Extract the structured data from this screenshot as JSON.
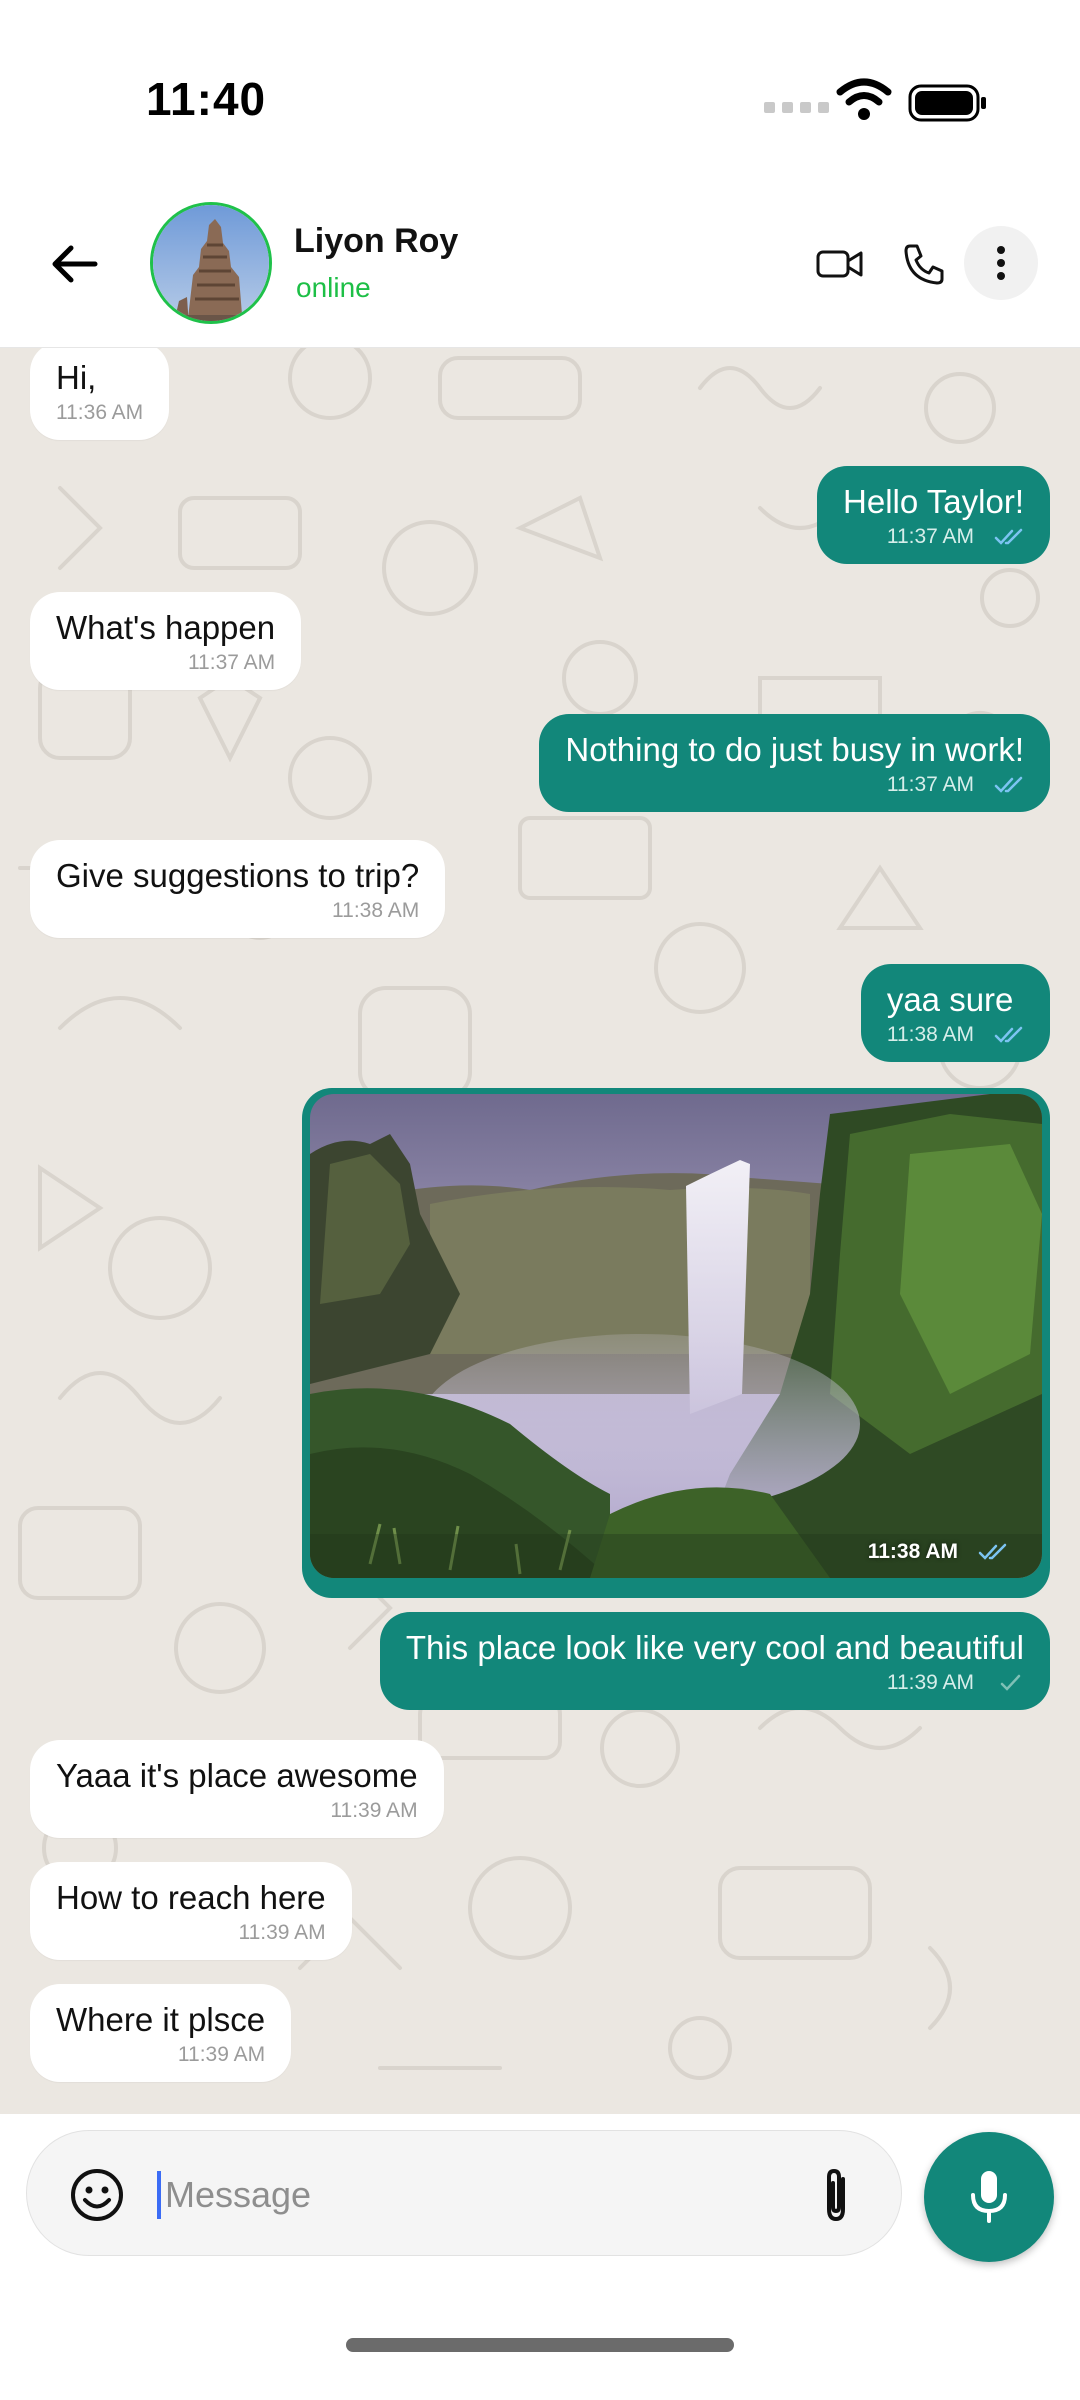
{
  "status_bar": {
    "time": "11:40"
  },
  "header": {
    "contact_name": "Liyon Roy",
    "contact_status": "online",
    "status_color": "#1dbf46"
  },
  "theme": {
    "outgoing_bubble": "#12877a",
    "incoming_bubble": "#ffffff",
    "chat_background": "#ebe7e1",
    "read_tick": "#7cc4f2"
  },
  "messages": [
    {
      "direction": "in",
      "text": "Hi,",
      "time": "11:36 AM"
    },
    {
      "direction": "out",
      "text": "Hello Taylor!",
      "time": "11:37 AM",
      "status": "read"
    },
    {
      "direction": "in",
      "text": "What's happen",
      "time": "11:37 AM"
    },
    {
      "direction": "out",
      "text": "Nothing to do just busy in work!",
      "time": "11:37 AM",
      "status": "read"
    },
    {
      "direction": "in",
      "text": "Give suggestions to trip?",
      "time": "11:38 AM"
    },
    {
      "direction": "out",
      "text": "yaa sure",
      "time": "11:38 AM",
      "status": "read"
    },
    {
      "direction": "out",
      "type": "image",
      "image": "waterfall-photo",
      "time": "11:38 AM",
      "status": "read"
    },
    {
      "direction": "out",
      "text": "This place look like very cool and beautiful",
      "time": "11:39 AM",
      "status": "sent"
    },
    {
      "direction": "in",
      "text": "Yaaa it's place awesome",
      "time": "11:39 AM"
    },
    {
      "direction": "in",
      "text": "How to reach here",
      "time": "11:39 AM"
    },
    {
      "direction": "in",
      "text": "Where it plsce",
      "time": "11:39 AM"
    }
  ],
  "composer": {
    "placeholder": "Message"
  },
  "icons": {
    "back": "arrow-left-icon",
    "video": "video-camera-icon",
    "call": "phone-icon",
    "more": "more-vertical-icon",
    "emoji": "smiley-icon",
    "attach": "paperclip-icon",
    "mic": "microphone-icon"
  }
}
